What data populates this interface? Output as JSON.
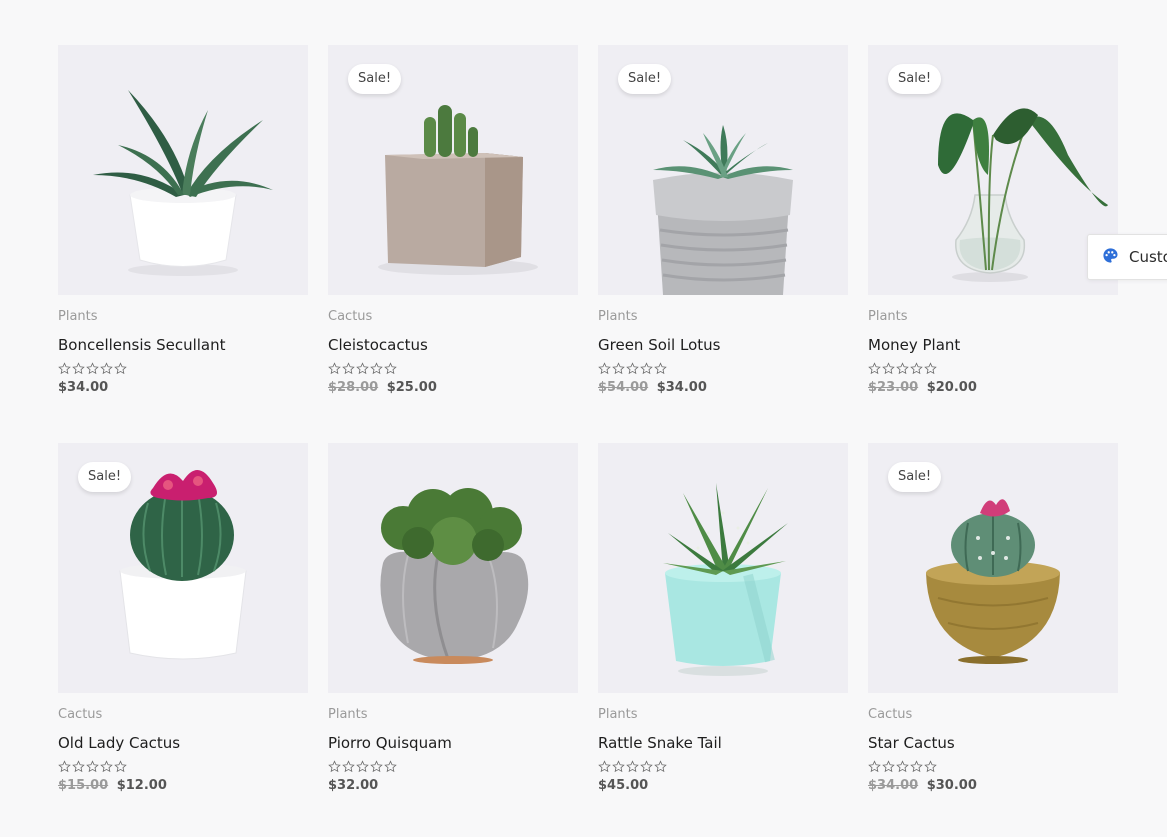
{
  "customize": {
    "label": "Custo",
    "icon": "palette-icon"
  },
  "products": [
    {
      "category": "Plants",
      "title": "Boncellensis Secullant",
      "sale": false,
      "old_price": "",
      "price": "$34.00",
      "image": "succulent-white-pot"
    },
    {
      "category": "Cactus",
      "title": "Cleistocactus",
      "sale": true,
      "old_price": "$28.00",
      "price": "$25.00",
      "image": "cactus-square-pot"
    },
    {
      "category": "Plants",
      "title": "Green Soil Lotus",
      "sale": true,
      "old_price": "$54.00",
      "price": "$34.00",
      "image": "succulent-grey-pot"
    },
    {
      "category": "Plants",
      "title": "Money Plant",
      "sale": true,
      "old_price": "$23.00",
      "price": "$20.00",
      "image": "leaves-glass-vase"
    },
    {
      "category": "Cactus",
      "title": "Old Lady Cactus",
      "sale": true,
      "old_price": "$15.00",
      "price": "$12.00",
      "image": "round-cactus-white-pot"
    },
    {
      "category": "Plants",
      "title": "Piorro Quisquam",
      "sale": false,
      "old_price": "",
      "price": "$32.00",
      "image": "moss-concrete-pot"
    },
    {
      "category": "Plants",
      "title": "Rattle Snake Tail",
      "sale": false,
      "old_price": "",
      "price": "$45.00",
      "image": "aloe-mint-pot"
    },
    {
      "category": "Cactus",
      "title": "Star Cactus",
      "sale": true,
      "old_price": "$34.00",
      "price": "$30.00",
      "image": "star-cactus-brass-pot"
    }
  ],
  "labels": {
    "sale": "Sale!"
  },
  "colors": {
    "background": "#f8f8f9",
    "thumb": "#efeef3",
    "accent": "#2e6fd8"
  }
}
